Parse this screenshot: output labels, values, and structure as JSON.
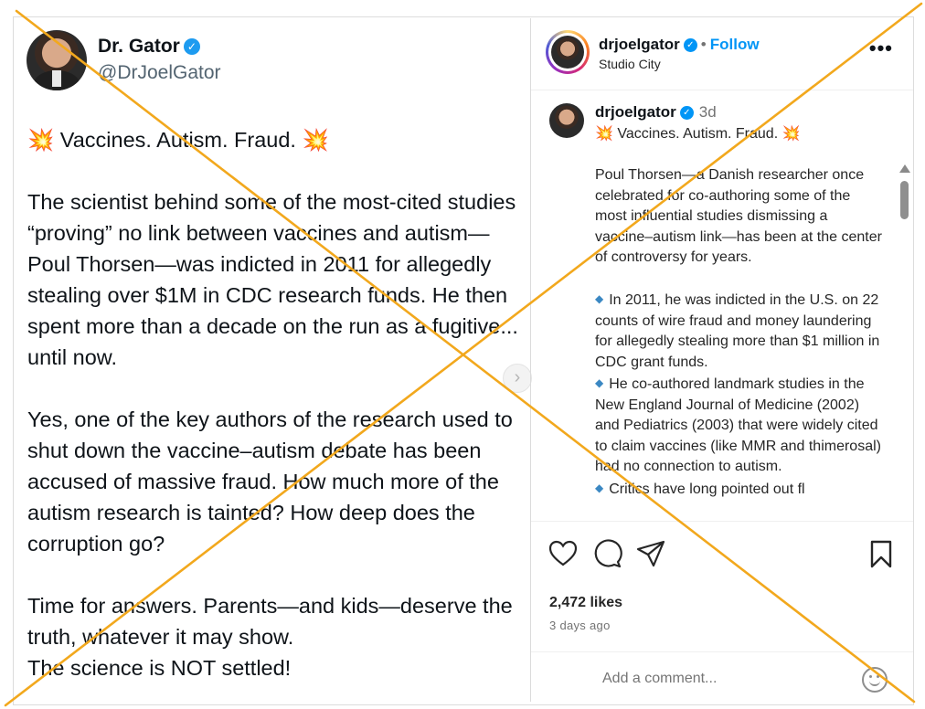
{
  "tweet": {
    "display_name": "Dr. Gator",
    "handle": "@DrJoelGator",
    "headline_emoji": "💥",
    "headline": "Vaccines. Autism. Fraud.",
    "paragraph1": "The scientist behind some of the most-cited studies “proving” no link between vaccines and autism—Poul Thorsen—was indicted in 2011 for allegedly stealing over $1M in CDC research funds. He then spent more than a decade on the run as a fugitive... until now.",
    "paragraph2": "Yes, one of the key authors of the research used to shut down the vaccine–autism debate has been accused of massive fraud. How much more of the autism research is tainted? How deep does the corruption go?",
    "paragraph3_line1": "Time for answers. Parents—and kids—deserve the truth, whatever it may show.",
    "paragraph3_line2": "The science is NOT settled!",
    "next_icon": "chevron-right-icon"
  },
  "instagram": {
    "username": "drjoelgator",
    "separator": "•",
    "follow_label": "Follow",
    "location": "Studio City",
    "more_icon": "•••",
    "caption": {
      "username": "drjoelgator",
      "time": "3d",
      "headline_emoji": "💥",
      "headline": "Vaccines. Autism. Fraud.",
      "paragraph1": "Poul Thorsen—a Danish researcher once celebrated for co-authoring some of the most influential studies dismissing a vaccine–autism link—has been at the center of controversy for years.",
      "bullet_icon": "◆",
      "bullet1": "In 2011, he was indicted in the U.S. on 22 counts of wire fraud and money laundering for allegedly stealing more than $1 million in CDC grant funds.",
      "bullet2": "He co-authored landmark studies in the New England Journal of Medicine (2002) and Pediatrics (2003) that were widely cited to claim vaccines (like MMR and thimerosal) had no connection to autism.",
      "bullet3_partial": "Critics have long pointed out fl"
    },
    "likes": "2,472 likes",
    "posted_ago": "3 days ago",
    "comment_placeholder": "Add a comment...",
    "colors": {
      "link": "#0095f6",
      "verified": "#0095f6",
      "overlay_x": "#f2a81d"
    }
  }
}
